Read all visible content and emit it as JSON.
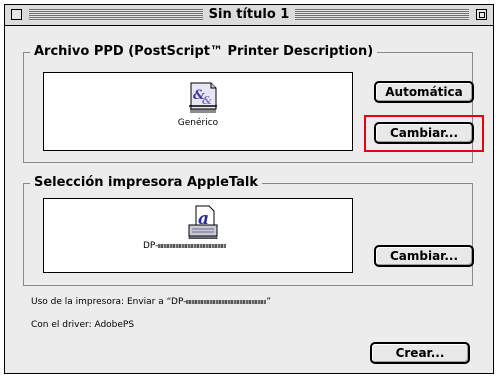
{
  "window": {
    "title": "Sin título 1"
  },
  "ppd_section": {
    "legend": "Archivo PPD (PostScript™ Printer Description)",
    "file_label": "Genérico",
    "icon": "ppd-document-icon",
    "auto_button": "Automática",
    "change_button": "Cambiar..."
  },
  "apple_section": {
    "legend": "Selección impresora AppleTalk",
    "printer_prefix": "DP-",
    "icon": "printer-icon",
    "change_button": "Cambiar..."
  },
  "status": {
    "usage_prefix": "Uso de la impresora: Enviar a “DP-",
    "usage_suffix": "”",
    "driver": "Con el driver: AdobePS"
  },
  "create_button": "Crear...",
  "colors": {
    "highlight": "#e8000e",
    "window_bg": "#ececec"
  }
}
